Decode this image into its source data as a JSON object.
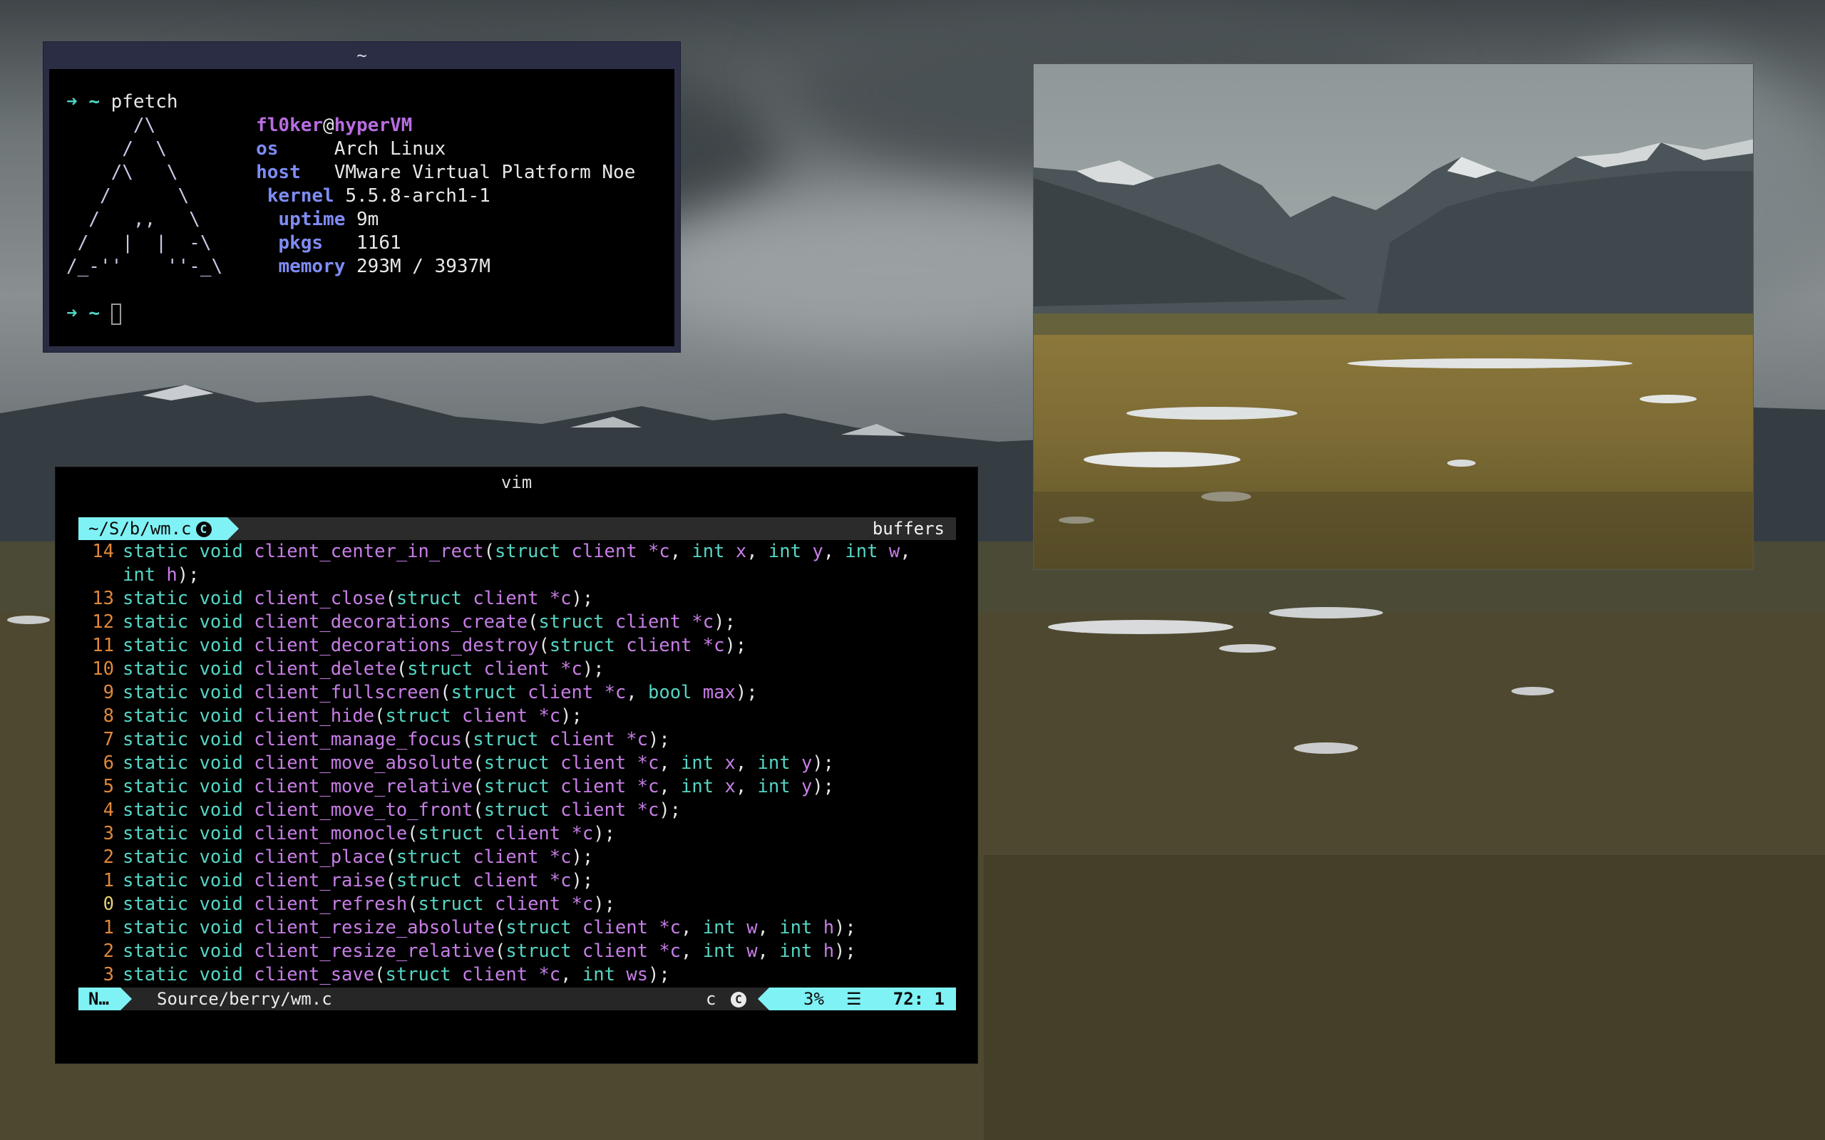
{
  "colors": {
    "term_bg": "#000000",
    "term_frame": "#2a2c44",
    "accent_cyan": "#7ff2f5",
    "keyword": "#55d6c4",
    "function": "#c77ee6",
    "line_number": "#e0883a"
  },
  "pfetch": {
    "title": "~",
    "prompt_arrow": "➜",
    "prompt_dir": "~",
    "command": "pfetch",
    "logo": [
      "      /\\",
      "     /  \\",
      "    /\\   \\",
      "   /      \\",
      "  /   ,,   \\",
      " /   |  |  -\\",
      "/_-''    ''-_\\"
    ],
    "user": "fl0ker",
    "at": "@",
    "host": "hyperVM",
    "info": [
      {
        "label": "os",
        "value": "Arch Linux"
      },
      {
        "label": "host",
        "value": "VMware Virtual Platform Noe"
      },
      {
        "label": "kernel",
        "value": "5.5.8-arch1-1"
      },
      {
        "label": "uptime",
        "value": "9m"
      },
      {
        "label": "pkgs",
        "value": "1161"
      },
      {
        "label": "memory",
        "value": "293M / 3937M"
      }
    ]
  },
  "vim": {
    "title": "vim",
    "tab_path": "~/S/b/wm.c",
    "tab_icon": "C",
    "buffers_label": "buffers",
    "lines": [
      {
        "n": "14",
        "name": "client_center_in_rect",
        "args": "(struct client *c, int x, int y, int w,"
      },
      {
        "n": "",
        "name": "",
        "args": "int h);",
        "wrap": true
      },
      {
        "n": "13",
        "name": "client_close",
        "args": "(struct client *c);"
      },
      {
        "n": "12",
        "name": "client_decorations_create",
        "args": "(struct client *c);"
      },
      {
        "n": "11",
        "name": "client_decorations_destroy",
        "args": "(struct client *c);"
      },
      {
        "n": "10",
        "name": "client_delete",
        "args": "(struct client *c);"
      },
      {
        "n": "9",
        "name": "client_fullscreen",
        "args": "(struct client *c, bool max);"
      },
      {
        "n": "8",
        "name": "client_hide",
        "args": "(struct client *c);"
      },
      {
        "n": "7",
        "name": "client_manage_focus",
        "args": "(struct client *c);"
      },
      {
        "n": "6",
        "name": "client_move_absolute",
        "args": "(struct client *c, int x, int y);"
      },
      {
        "n": "5",
        "name": "client_move_relative",
        "args": "(struct client *c, int x, int y);"
      },
      {
        "n": "4",
        "name": "client_move_to_front",
        "args": "(struct client *c);"
      },
      {
        "n": "3",
        "name": "client_monocle",
        "args": "(struct client *c);"
      },
      {
        "n": "2",
        "name": "client_place",
        "args": "(struct client *c);"
      },
      {
        "n": "1",
        "name": "client_raise",
        "args": "(struct client *c);"
      },
      {
        "n": "0",
        "name": "client_refresh",
        "args": "(struct client *c);",
        "current": true
      },
      {
        "n": "1",
        "name": "client_resize_absolute",
        "args": "(struct client *c, int w, int h);"
      },
      {
        "n": "2",
        "name": "client_resize_relative",
        "args": "(struct client *c, int w, int h);"
      },
      {
        "n": "3",
        "name": "client_save",
        "args": "(struct client *c, int ws);"
      }
    ],
    "status": {
      "mode": "N…",
      "file": "Source/berry/wm.c",
      "filetype": "c",
      "filetype_icon": "C",
      "percent": "3%",
      "lines_icon": "☰",
      "position": "72:  1"
    }
  }
}
